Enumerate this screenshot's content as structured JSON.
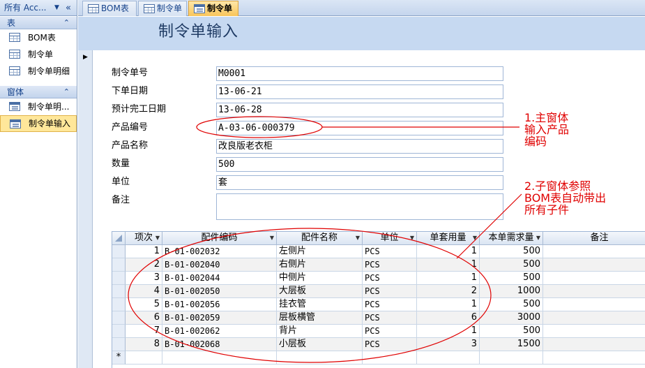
{
  "nav": {
    "header": "所有 Acc...",
    "groups": [
      {
        "label": "表",
        "items": [
          "BOM表",
          "制令单",
          "制令单明细"
        ]
      },
      {
        "label": "窗体",
        "items": [
          "制令单明...",
          "制令单输入"
        ]
      }
    ]
  },
  "tabs": [
    "BOM表",
    "制令单",
    "制令单"
  ],
  "form": {
    "title": "制令单输入",
    "fields": [
      {
        "label": "制令单号",
        "value": "M0001"
      },
      {
        "label": "下单日期",
        "value": "13-06-21"
      },
      {
        "label": "预计完工日期",
        "value": "13-06-28"
      },
      {
        "label": "产品编号",
        "value": "A-03-06-000379"
      },
      {
        "label": "产品名称",
        "value": "改良版老衣柜"
      },
      {
        "label": "数量",
        "value": "500"
      },
      {
        "label": "单位",
        "value": "套"
      },
      {
        "label": "备注",
        "value": ""
      }
    ]
  },
  "subform": {
    "columns": [
      "项次",
      "配件编码",
      "配件名称",
      "单位",
      "单套用量",
      "本单需求量",
      "备注"
    ],
    "rows": [
      [
        "1",
        "B-01-002032",
        "左侧片",
        "PCS",
        "1",
        "500",
        ""
      ],
      [
        "2",
        "B-01-002040",
        "右侧片",
        "PCS",
        "1",
        "500",
        ""
      ],
      [
        "3",
        "B-01-002044",
        "中侧片",
        "PCS",
        "1",
        "500",
        ""
      ],
      [
        "4",
        "B-01-002050",
        "大层板",
        "PCS",
        "2",
        "1000",
        ""
      ],
      [
        "5",
        "B-01-002056",
        "挂衣管",
        "PCS",
        "1",
        "500",
        ""
      ],
      [
        "6",
        "B-01-002059",
        "层板横管",
        "PCS",
        "6",
        "3000",
        ""
      ],
      [
        "7",
        "B-01-002062",
        "背片",
        "PCS",
        "1",
        "500",
        ""
      ],
      [
        "8",
        "B-01-002068",
        "小层板",
        "PCS",
        "3",
        "1500",
        ""
      ]
    ],
    "new_row_marker": "*"
  },
  "annotations": {
    "note1": [
      "1.主窗体",
      "输入产品",
      "编码"
    ],
    "note2": [
      "2.子窗体参照",
      "BOM表自动带出",
      "所有子件"
    ],
    "color": "#e00000"
  },
  "colors": {
    "accent": "#c6d9f1",
    "active_tab": "#f8c55a",
    "selected_nav": "#ffe79a"
  }
}
